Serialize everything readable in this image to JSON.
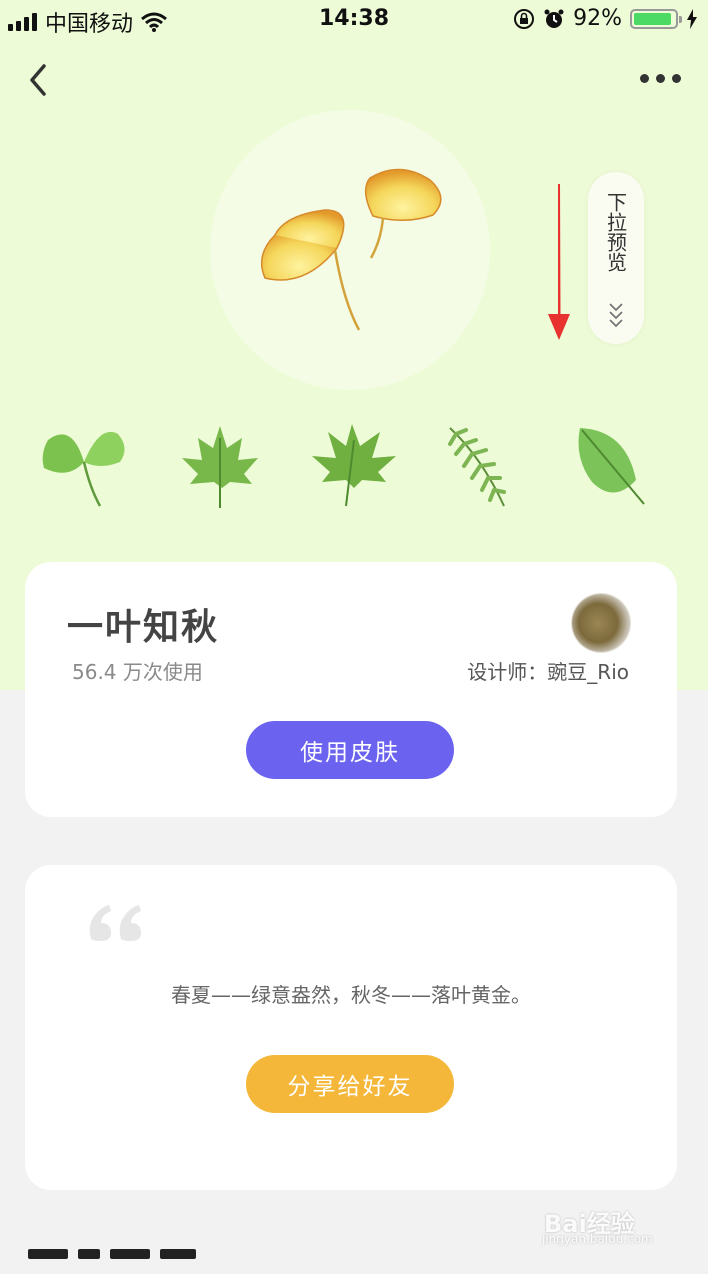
{
  "status_bar": {
    "carrier": "中国移动",
    "time": "14:38",
    "battery_text": "92%",
    "battery_level": 0.92,
    "icons": [
      "signal-icon",
      "wifi-icon",
      "rotation-lock-icon",
      "alarm-icon",
      "battery-icon",
      "charging-icon"
    ]
  },
  "nav": {
    "back_icon": "chevron-left-icon",
    "more_icon": "more-dots-icon"
  },
  "preview": {
    "label": "下拉预览",
    "icon": "double-chevron-down-icon"
  },
  "annotation": {
    "icon": "red-arrow-down-icon"
  },
  "leaves": [
    "ginkgo-leaf-icon",
    "maple-leaf-icon",
    "maple-leaf-icon",
    "fern-leaf-icon",
    "oval-leaf-icon"
  ],
  "skin": {
    "title": "一叶知秋",
    "usage": "56.4 万次使用",
    "designer": "设计师：豌豆_Rio",
    "use_button": "使用皮肤"
  },
  "quote_card": {
    "description": "春夏——绿意盎然，秋冬——落叶黄金。",
    "share_button": "分享给好友"
  },
  "watermark": {
    "main": "Bai经验",
    "sub": "jingyan.baidu.com"
  },
  "colors": {
    "hero_bg": "#eefbd7",
    "primary_button": "#6b63f0",
    "share_button": "#f4b73a",
    "annotation": "#e8322f"
  }
}
